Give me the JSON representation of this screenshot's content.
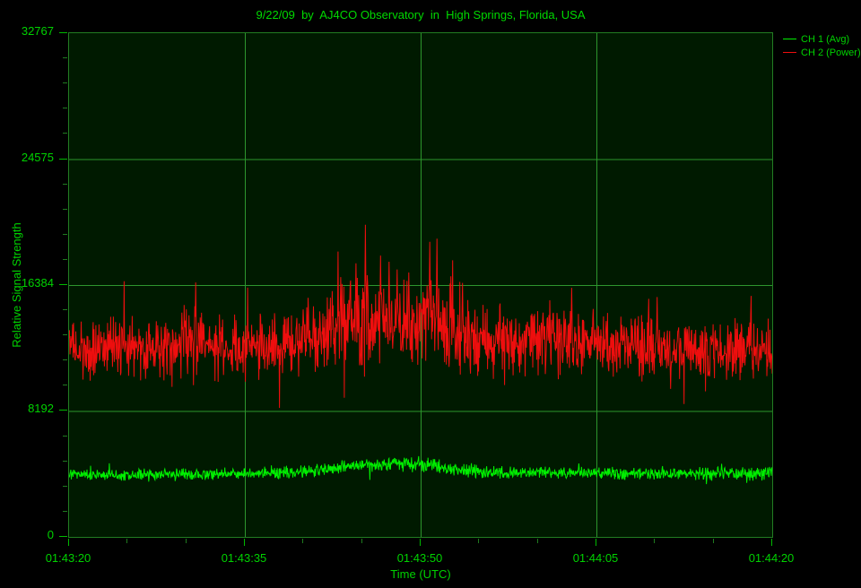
{
  "colors": {
    "background": "#000000",
    "plot_background": "#001a00",
    "plot_border": "#227d22",
    "grid": "#2d962d",
    "tick_major": "#00b900",
    "tick_minor": "#1f7a1f",
    "text": "#00d200",
    "title_text": "#00d900",
    "ch1": "#00ef00",
    "ch2": "#ee0e0e"
  },
  "legend": {
    "items": [
      {
        "label": "CH 1 (Avg)",
        "color": "#00ef00"
      },
      {
        "label": "CH 2 (Power)",
        "color": "#ee0e0e"
      }
    ]
  },
  "chart_data": {
    "type": "line",
    "title": "9/22/09  by  AJ4CO Observatory  in  High Springs, Florida, USA",
    "xlabel": "Time (UTC)",
    "ylabel": "Relative Signal Strength",
    "grid": true,
    "legend_position": "top-right-outside",
    "ylim": [
      0,
      32767
    ],
    "y_ticks": [
      0,
      8192,
      16384,
      24575,
      32767
    ],
    "y_minor_divisions": 20,
    "x_span_seconds": 60,
    "x_tick_seconds": [
      0,
      15,
      30,
      45,
      60
    ],
    "x_tick_labels": [
      "01:43:20",
      "01:43:35",
      "01:43:50",
      "01:44:05",
      "01:44:20"
    ],
    "x_minor_interval_seconds": 5,
    "series": [
      {
        "name": "CH 1 (Avg)",
        "color": "#00ef00",
        "description": "green average-channel trace, noisy baseline near 4100 with a broad gentle rise to about 4800 between 01:43:42 and 01:43:54",
        "envelope": [
          [
            0,
            4050,
            270
          ],
          [
            5,
            4050,
            270
          ],
          [
            10,
            4080,
            280
          ],
          [
            15,
            4120,
            280
          ],
          [
            18,
            4150,
            290
          ],
          [
            20,
            4250,
            300
          ],
          [
            22,
            4400,
            310
          ],
          [
            24,
            4550,
            330
          ],
          [
            26,
            4700,
            340
          ],
          [
            28,
            4750,
            350
          ],
          [
            30,
            4700,
            350
          ],
          [
            31,
            4650,
            340
          ],
          [
            32,
            4500,
            330
          ],
          [
            33,
            4400,
            320
          ],
          [
            34,
            4300,
            310
          ],
          [
            36,
            4200,
            300
          ],
          [
            38,
            4150,
            300
          ],
          [
            40,
            4150,
            300
          ],
          [
            44,
            4150,
            300
          ],
          [
            48,
            4120,
            300
          ],
          [
            52,
            4120,
            300
          ],
          [
            56,
            4120,
            310
          ],
          [
            60,
            4150,
            320
          ]
        ],
        "peaks": [
          [
            25.4,
            5050
          ],
          [
            28.6,
            5150
          ],
          [
            30.9,
            5000
          ],
          [
            43.5,
            4780
          ],
          [
            55.7,
            4760
          ]
        ]
      },
      {
        "name": "CH 2 (Power)",
        "color": "#ee0e0e",
        "description": "red power-channel trace, noisy baseline near 12300 with a burst rising to about 14300 mean (spikes past 20000) between 01:43:41 and 01:43:53",
        "envelope": [
          [
            0,
            12200,
            1500
          ],
          [
            3,
            12300,
            1500
          ],
          [
            6,
            12200,
            1550
          ],
          [
            9,
            12400,
            1600
          ],
          [
            11,
            12500,
            1750
          ],
          [
            13,
            12300,
            1550
          ],
          [
            15,
            12300,
            1500
          ],
          [
            17,
            12400,
            1550
          ],
          [
            19,
            12700,
            1650
          ],
          [
            21,
            13200,
            1850
          ],
          [
            23,
            13800,
            2050
          ],
          [
            25,
            14300,
            2250
          ],
          [
            26,
            14200,
            2200
          ],
          [
            27,
            14000,
            2150
          ],
          [
            28,
            13900,
            2100
          ],
          [
            29,
            14000,
            2150
          ],
          [
            30,
            14300,
            2300
          ],
          [
            31,
            14300,
            2350
          ],
          [
            32,
            13800,
            2100
          ],
          [
            33,
            13300,
            1950
          ],
          [
            34,
            13000,
            1850
          ],
          [
            36,
            12700,
            1750
          ],
          [
            38,
            12600,
            1700
          ],
          [
            40,
            12700,
            1750
          ],
          [
            42,
            12900,
            1850
          ],
          [
            43,
            12900,
            1850
          ],
          [
            44,
            12600,
            1700
          ],
          [
            46,
            12400,
            1600
          ],
          [
            48,
            12300,
            1550
          ],
          [
            50,
            12200,
            1500
          ],
          [
            53,
            12300,
            1500
          ],
          [
            56,
            12200,
            1500
          ],
          [
            58,
            12300,
            1500
          ],
          [
            60,
            12200,
            1500
          ]
        ],
        "peaks": [
          [
            10.8,
            16550
          ],
          [
            23.2,
            16900
          ],
          [
            24.5,
            17800
          ],
          [
            25.3,
            20300
          ],
          [
            26.6,
            18300
          ],
          [
            27.3,
            17900
          ],
          [
            28.0,
            17400
          ],
          [
            29.0,
            17200
          ],
          [
            30.8,
            19200
          ],
          [
            31.4,
            19400
          ],
          [
            42.9,
            16200
          ],
          [
            50.2,
            15600
          ]
        ]
      }
    ]
  }
}
